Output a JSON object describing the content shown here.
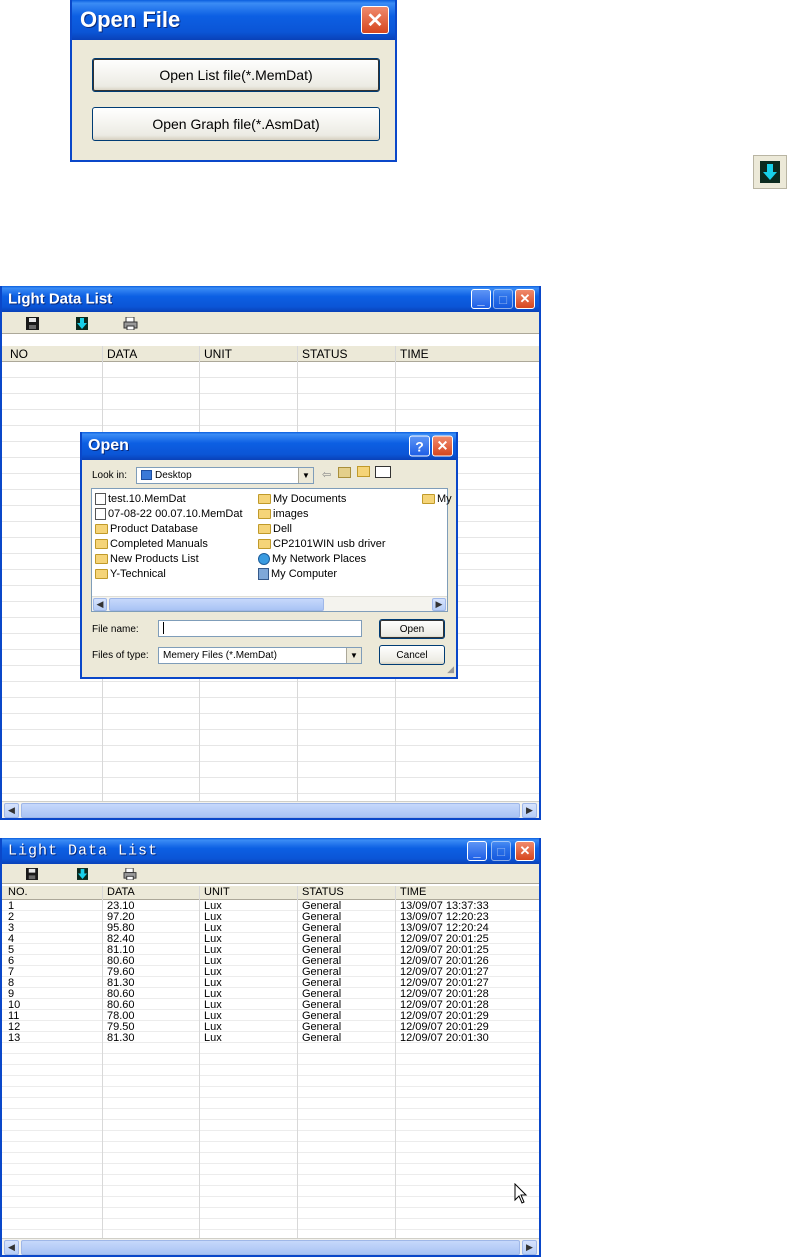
{
  "open_file_dialog": {
    "title": "Open File",
    "close_glyph": "✕",
    "buttons": [
      "Open List file(*.MemDat)",
      "Open Graph file(*.AsmDat)"
    ]
  },
  "standalone_icon": "download-arrow-icon",
  "list_window_1": {
    "title": "Light Data List",
    "columns": [
      "NO",
      "DATA",
      "UNIT",
      "STATUS",
      "TIME"
    ]
  },
  "open_dialog": {
    "title": "Open",
    "help_glyph": "?",
    "close_glyph": "✕",
    "look_in_label": "Look in:",
    "look_in_value": "Desktop",
    "files": {
      "col1": [
        "test.10.MemDat",
        "07-08-22 00.07.10.MemDat",
        "Product Database",
        "Completed Manuals",
        "New Products List",
        "Y-Technical"
      ],
      "col2": [
        "My Documents",
        "images",
        "Dell",
        "CP2101WIN usb driver",
        "My Network Places",
        "My Computer"
      ],
      "col3": [
        "My"
      ]
    },
    "file_name_label": "File name:",
    "file_name_value": "",
    "files_of_type_label": "Files of type:",
    "files_of_type_value": "Memery Files (*.MemDat)",
    "open_label": "Open",
    "cancel_label": "Cancel"
  },
  "list_window_2": {
    "title": "Light Data List",
    "columns": [
      "NO.",
      "DATA",
      "UNIT",
      "STATUS",
      "TIME"
    ],
    "rows": [
      [
        "1",
        "23.10",
        "Lux",
        "General",
        "13/09/07 13:37:33"
      ],
      [
        "2",
        "97.20",
        "Lux",
        "General",
        "13/09/07 12:20:23"
      ],
      [
        "3",
        "95.80",
        "Lux",
        "General",
        "13/09/07 12:20:24"
      ],
      [
        "4",
        "82.40",
        "Lux",
        "General",
        "12/09/07 20:01:25"
      ],
      [
        "5",
        "81.10",
        "Lux",
        "General",
        "12/09/07 20:01:25"
      ],
      [
        "6",
        "80.60",
        "Lux",
        "General",
        "12/09/07 20:01:26"
      ],
      [
        "7",
        "79.60",
        "Lux",
        "General",
        "12/09/07 20:01:27"
      ],
      [
        "8",
        "81.30",
        "Lux",
        "General",
        "12/09/07 20:01:27"
      ],
      [
        "9",
        "80.60",
        "Lux",
        "General",
        "12/09/07 20:01:28"
      ],
      [
        "10",
        "80.60",
        "Lux",
        "General",
        "12/09/07 20:01:28"
      ],
      [
        "11",
        "78.00",
        "Lux",
        "General",
        "12/09/07 20:01:29"
      ],
      [
        "12",
        "79.50",
        "Lux",
        "General",
        "12/09/07 20:01:29"
      ],
      [
        "13",
        "81.30",
        "Lux",
        "General",
        "12/09/07 20:01:30"
      ]
    ]
  },
  "toolbar_icons": [
    "save-icon",
    "download-icon",
    "print-icon"
  ]
}
